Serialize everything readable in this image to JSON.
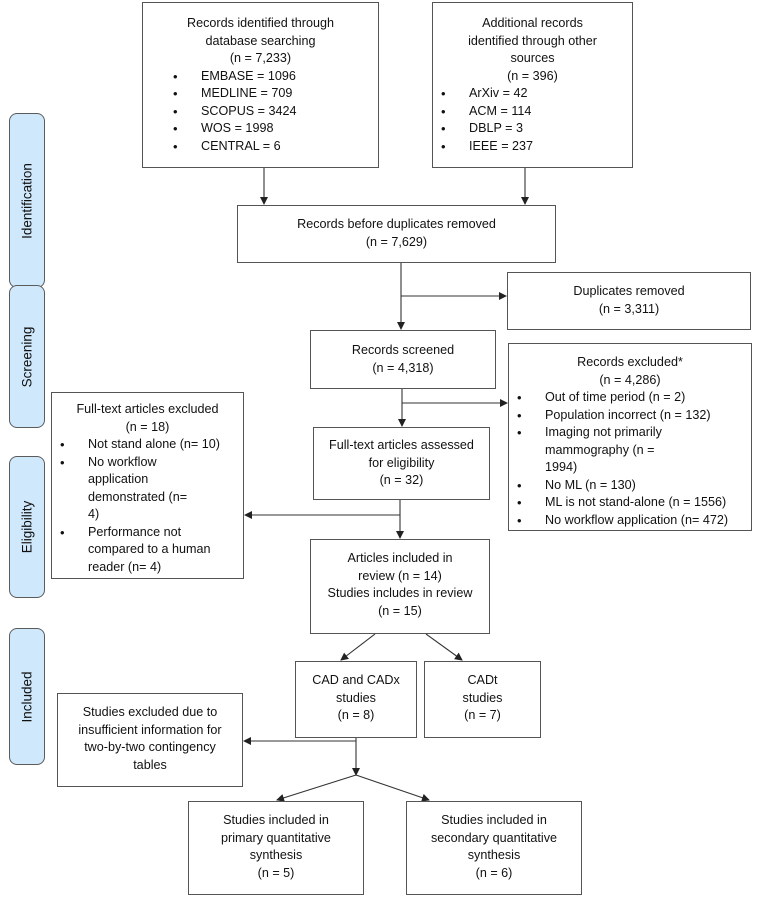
{
  "phases": [
    {
      "id": "identification",
      "label": "Identification"
    },
    {
      "id": "screening",
      "label": "Screening"
    },
    {
      "id": "eligibility",
      "label": "Eligibility"
    },
    {
      "id": "included",
      "label": "Included"
    }
  ],
  "boxes": {
    "database_search": {
      "title_lines": [
        "Records identified through",
        "database searching",
        "(n = 7,233)"
      ],
      "items": [
        "EMBASE = 1096",
        "MEDLINE = 709",
        "SCOPUS = 3424",
        "WOS = 1998",
        "CENTRAL = 6"
      ]
    },
    "other_sources": {
      "title_lines": [
        "Additional records",
        "identified through other",
        "sources",
        "(n = 396)"
      ],
      "items": [
        "ArXiv = 42",
        "ACM = 114",
        "DBLP = 3",
        "IEEE = 237"
      ]
    },
    "before_duplicates": {
      "title_lines": [
        "Records before duplicates removed",
        "(n = 7,629)"
      ]
    },
    "duplicates_removed": {
      "title_lines": [
        "Duplicates removed",
        "(n = 3,311)"
      ]
    },
    "records_screened": {
      "title_lines": [
        "Records screened",
        "(n = 4,318)"
      ]
    },
    "records_excluded": {
      "title_lines": [
        "Records excluded*",
        "(n = 4,286)"
      ],
      "items": [
        "Out of time period (n = 2)",
        "Population incorrect (n = 132)",
        "Imaging not primarily mammography (n = 1994)",
        "No ML (n = 130)",
        "ML is not stand-alone (n = 1556)",
        "No workflow application (n= 472)"
      ]
    },
    "fulltext_excluded": {
      "title_lines": [
        "Full-text articles excluded",
        "(n = 18)"
      ],
      "items": [
        "Not stand alone (n= 10)",
        "No workflow application demonstrated (n= 4)",
        "Performance not compared to a human reader (n= 4)"
      ]
    },
    "fulltext_assessed": {
      "title_lines": [
        "Full-text articles assessed",
        "for eligibility",
        "(n = 32)"
      ]
    },
    "included_review": {
      "title_lines": [
        "Articles included in",
        "review (n = 14)",
        "Studies includes in review",
        "(n = 15)"
      ]
    },
    "cad_cadx": {
      "title_lines": [
        "CAD and CADx",
        "studies",
        "(n = 8)"
      ]
    },
    "cadt": {
      "title_lines": [
        "CADt",
        "studies",
        "(n = 7)"
      ]
    },
    "insufficient_info": {
      "title_lines": [
        "Studies excluded due to",
        "insufficient information for",
        "two-by-two contingency",
        "tables"
      ]
    },
    "primary_synthesis": {
      "title_lines": [
        "Studies included in",
        "primary quantitative",
        "synthesis",
        "(n = 5)"
      ]
    },
    "secondary_synthesis": {
      "title_lines": [
        "Studies included in",
        "secondary quantitative",
        "synthesis",
        "(n = 6)"
      ]
    }
  },
  "colors": {
    "phase_fill": "#cfe8fb",
    "line": "#222222"
  }
}
